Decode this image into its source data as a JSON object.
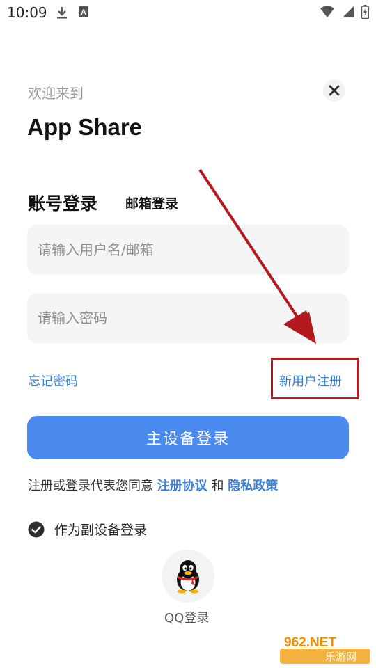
{
  "status_bar": {
    "time": "10:09",
    "left_icons": [
      "download-icon",
      "font-a-icon"
    ],
    "right_icons": [
      "wifi-icon",
      "signal-icon",
      "battery-icon"
    ]
  },
  "header": {
    "welcome": "欢迎来到",
    "title": "App Share",
    "close_icon": "close-icon"
  },
  "tabs": {
    "account": "账号登录",
    "email": "邮箱登录"
  },
  "form": {
    "username_placeholder": "请输入用户名/邮箱",
    "username_value": "",
    "password_placeholder": "请输入密码",
    "password_value": ""
  },
  "links": {
    "forgot": "忘记密码",
    "register": "新用户注册"
  },
  "login_button": "主设备登录",
  "agreement": {
    "prefix": "注册或登录代表您同意",
    "terms": "注册协议",
    "and": "和",
    "privacy": "隐私政策"
  },
  "secondary_login": {
    "label": "作为副设备登录",
    "checked": true
  },
  "qq": {
    "label": "QQ登录",
    "icon": "qq-penguin-icon"
  },
  "watermark": {
    "top": "962.NET",
    "bottom": "乐游网"
  },
  "colors": {
    "accent": "#4a89ee",
    "link": "#3d7fd6",
    "annotation": "#b3191d",
    "input_bg": "#f5f5f7"
  }
}
